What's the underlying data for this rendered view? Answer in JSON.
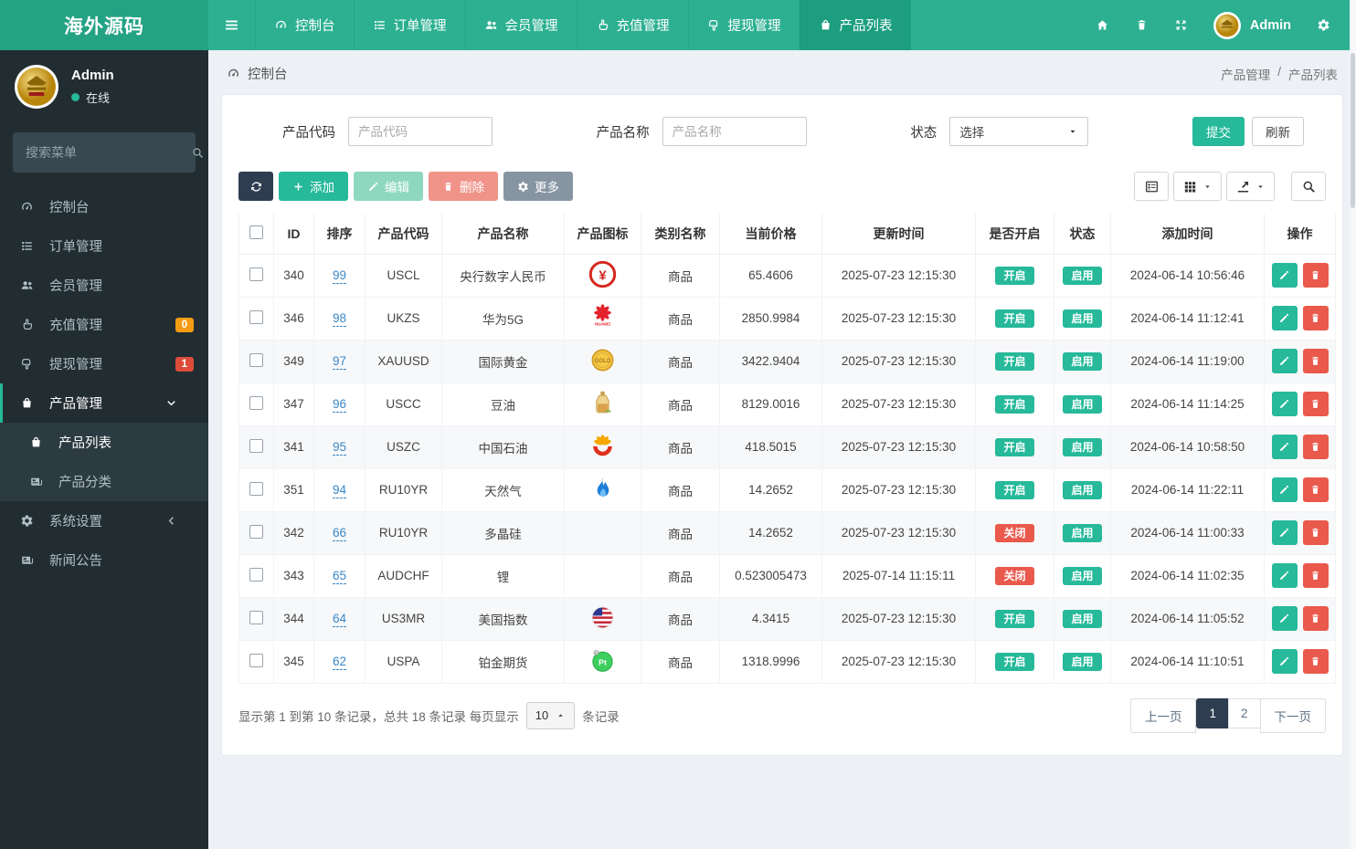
{
  "brand": {
    "title": "海外源码"
  },
  "topnav": {
    "items": [
      {
        "label": "控制台"
      },
      {
        "label": "订单管理"
      },
      {
        "label": "会员管理"
      },
      {
        "label": "充值管理"
      },
      {
        "label": "提现管理"
      },
      {
        "label": "产品列表",
        "active": true
      }
    ],
    "user_name": "Admin"
  },
  "sidebar": {
    "user": {
      "name": "Admin",
      "status": "在线"
    },
    "search_placeholder": "搜索菜单",
    "items": [
      {
        "label": "控制台"
      },
      {
        "label": "订单管理"
      },
      {
        "label": "会员管理"
      },
      {
        "label": "充值管理",
        "badge": "0"
      },
      {
        "label": "提现管理",
        "badge": "1"
      },
      {
        "label": "产品管理",
        "active": true
      },
      {
        "label": "产品列表",
        "active": true
      },
      {
        "label": "产品分类"
      },
      {
        "label": "系统设置"
      },
      {
        "label": "新闻公告"
      }
    ]
  },
  "breadcrumb": {
    "left": "控制台",
    "parent": "产品管理",
    "separator": "/",
    "current": "产品列表"
  },
  "filters": {
    "code_label": "产品代码",
    "code_placeholder": "产品代码",
    "name_label": "产品名称",
    "name_placeholder": "产品名称",
    "status_label": "状态",
    "status_value": "选择",
    "submit_label": "提交",
    "refresh_label": "刷新"
  },
  "toolbar": {
    "add_label": "添加",
    "edit_label": "编辑",
    "delete_label": "删除",
    "more_label": "更多"
  },
  "table": {
    "columns": [
      "ID",
      "排序",
      "产品代码",
      "产品名称",
      "产品图标",
      "类别名称",
      "当前价格",
      "更新时间",
      "是否开启",
      "状态",
      "添加时间",
      "操作"
    ],
    "open_badge": {
      "on": "开启",
      "off": "关闭"
    },
    "status_badge": {
      "enabled": "启用"
    },
    "rows": [
      {
        "id": "340",
        "sort": "99",
        "code": "USCL",
        "name": "央行数字人民币",
        "icon": "digital-yuan",
        "category": "商品",
        "price": "65.4606",
        "updated": "2025-07-23 12:15:30",
        "open": "on",
        "status": "enabled",
        "added": "2024-06-14 10:56:46"
      },
      {
        "id": "346",
        "sort": "98",
        "code": "UKZS",
        "name": "华为5G",
        "icon": "huawei",
        "category": "商品",
        "price": "2850.9984",
        "updated": "2025-07-23 12:15:30",
        "open": "on",
        "status": "enabled",
        "added": "2024-06-14 11:12:41"
      },
      {
        "id": "349",
        "sort": "97",
        "code": "XAUUSD",
        "name": "国际黄金",
        "icon": "gold",
        "category": "商品",
        "price": "3422.9404",
        "updated": "2025-07-23 12:15:30",
        "open": "on",
        "status": "enabled",
        "added": "2024-06-14 11:19:00"
      },
      {
        "id": "347",
        "sort": "96",
        "code": "USCC",
        "name": "豆油",
        "icon": "oil-bottle",
        "category": "商品",
        "price": "8129.0016",
        "updated": "2025-07-23 12:15:30",
        "open": "on",
        "status": "enabled",
        "added": "2024-06-14 11:14:25"
      },
      {
        "id": "341",
        "sort": "95",
        "code": "USZC",
        "name": "中国石油",
        "icon": "petrochina",
        "category": "商品",
        "price": "418.5015",
        "updated": "2025-07-23 12:15:30",
        "open": "on",
        "status": "enabled",
        "added": "2024-06-14 10:58:50"
      },
      {
        "id": "351",
        "sort": "94",
        "code": "RU10YR",
        "name": "天然气",
        "icon": "flame",
        "category": "商品",
        "price": "14.2652",
        "updated": "2025-07-23 12:15:30",
        "open": "on",
        "status": "enabled",
        "added": "2024-06-14 11:22:11"
      },
      {
        "id": "342",
        "sort": "66",
        "code": "RU10YR",
        "name": "多晶硅",
        "icon": "",
        "category": "商品",
        "price": "14.2652",
        "updated": "2025-07-23 12:15:30",
        "open": "off",
        "status": "enabled",
        "added": "2024-06-14 11:00:33"
      },
      {
        "id": "343",
        "sort": "65",
        "code": "AUDCHF",
        "name": "锂",
        "icon": "",
        "category": "商品",
        "price": "0.523005473",
        "updated": "2025-07-14 11:15:11",
        "open": "off",
        "status": "enabled",
        "added": "2024-06-14 11:02:35"
      },
      {
        "id": "344",
        "sort": "64",
        "code": "US3MR",
        "name": "美国指数",
        "icon": "us-flag",
        "category": "商品",
        "price": "4.3415",
        "updated": "2025-07-23 12:15:30",
        "open": "on",
        "status": "enabled",
        "added": "2024-06-14 11:05:52"
      },
      {
        "id": "345",
        "sort": "62",
        "code": "USPA",
        "name": "铂金期货",
        "icon": "platinum",
        "category": "商品",
        "price": "1318.9996",
        "updated": "2025-07-23 12:15:30",
        "open": "on",
        "status": "enabled",
        "added": "2024-06-14 11:10:51"
      }
    ]
  },
  "pagination": {
    "summary_prefix": "显示第 1 到第 10 条记录，总共 18 条记录 每页显示",
    "page_size": "10",
    "summary_suffix": "条记录",
    "prev_label": "上一页",
    "pages": [
      "1",
      "2"
    ],
    "active_page": "1",
    "next_label": "下一页"
  },
  "colors": {
    "accent_teal": "#26b99a",
    "navbar_teal": "#2cb091",
    "logo_teal": "#23a284",
    "nav_active_teal": "#1e9e81",
    "sidebar_dark": "#222d32",
    "submenu_dark": "#2c3b41",
    "badge_orange": "#f39c12",
    "badge_sidebar_red": "#dd4b39",
    "badge_red": "#e9594c",
    "dark_button": "#2e3d50",
    "link_blue": "#3a87c8"
  }
}
